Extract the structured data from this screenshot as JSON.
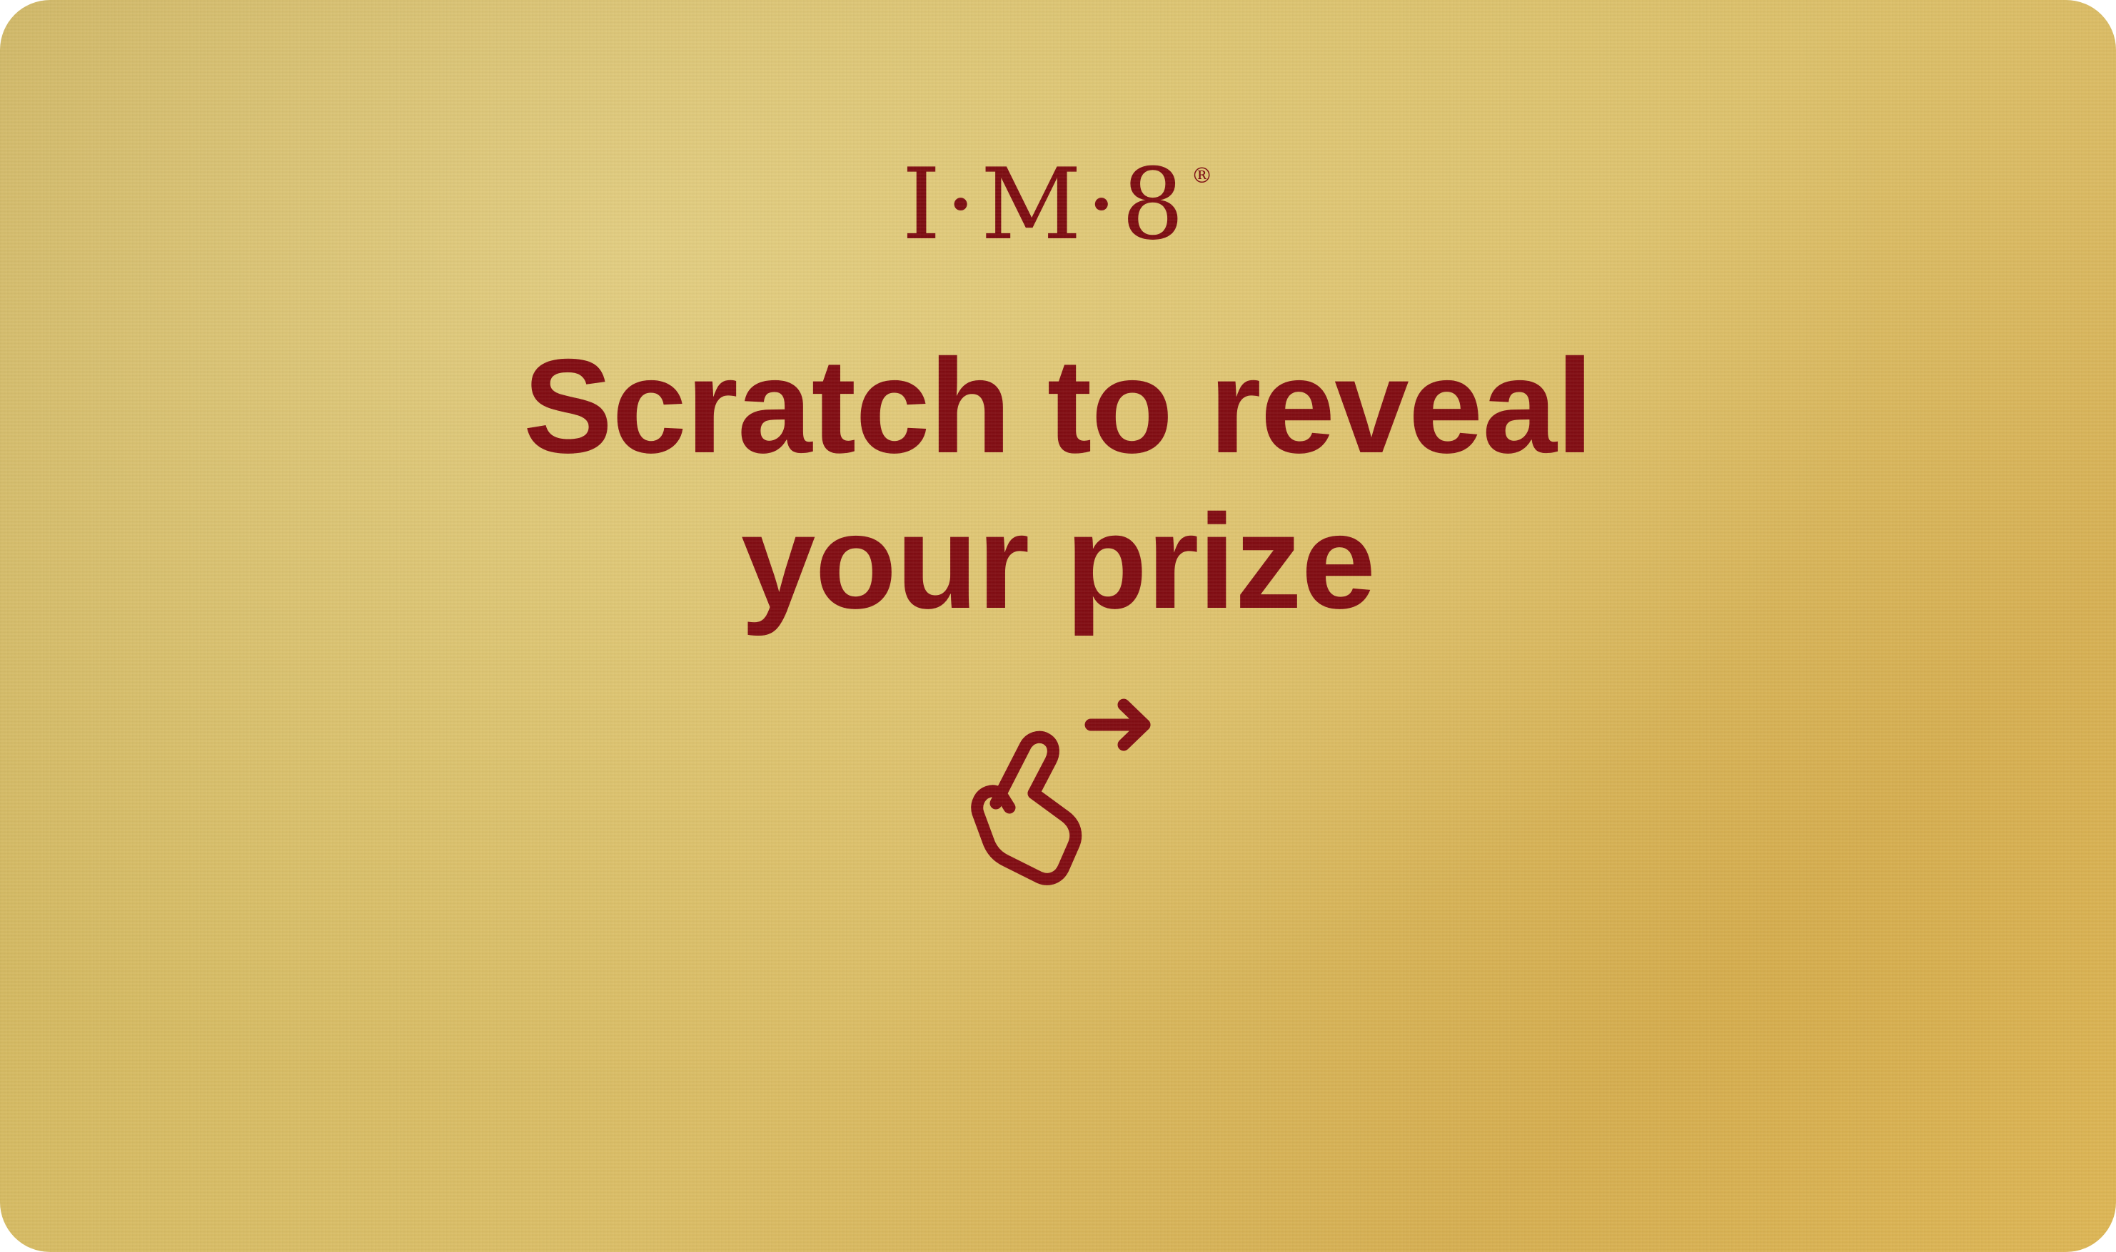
{
  "card": {
    "logo": "I·M·8",
    "logo_mark": "®",
    "headline_line1": "Scratch to reveal",
    "headline_line2": "your prize",
    "gesture_icon": "swipe-finger-right-icon"
  },
  "colors": {
    "gold": "#d6bb63",
    "accent": "#820d13"
  }
}
